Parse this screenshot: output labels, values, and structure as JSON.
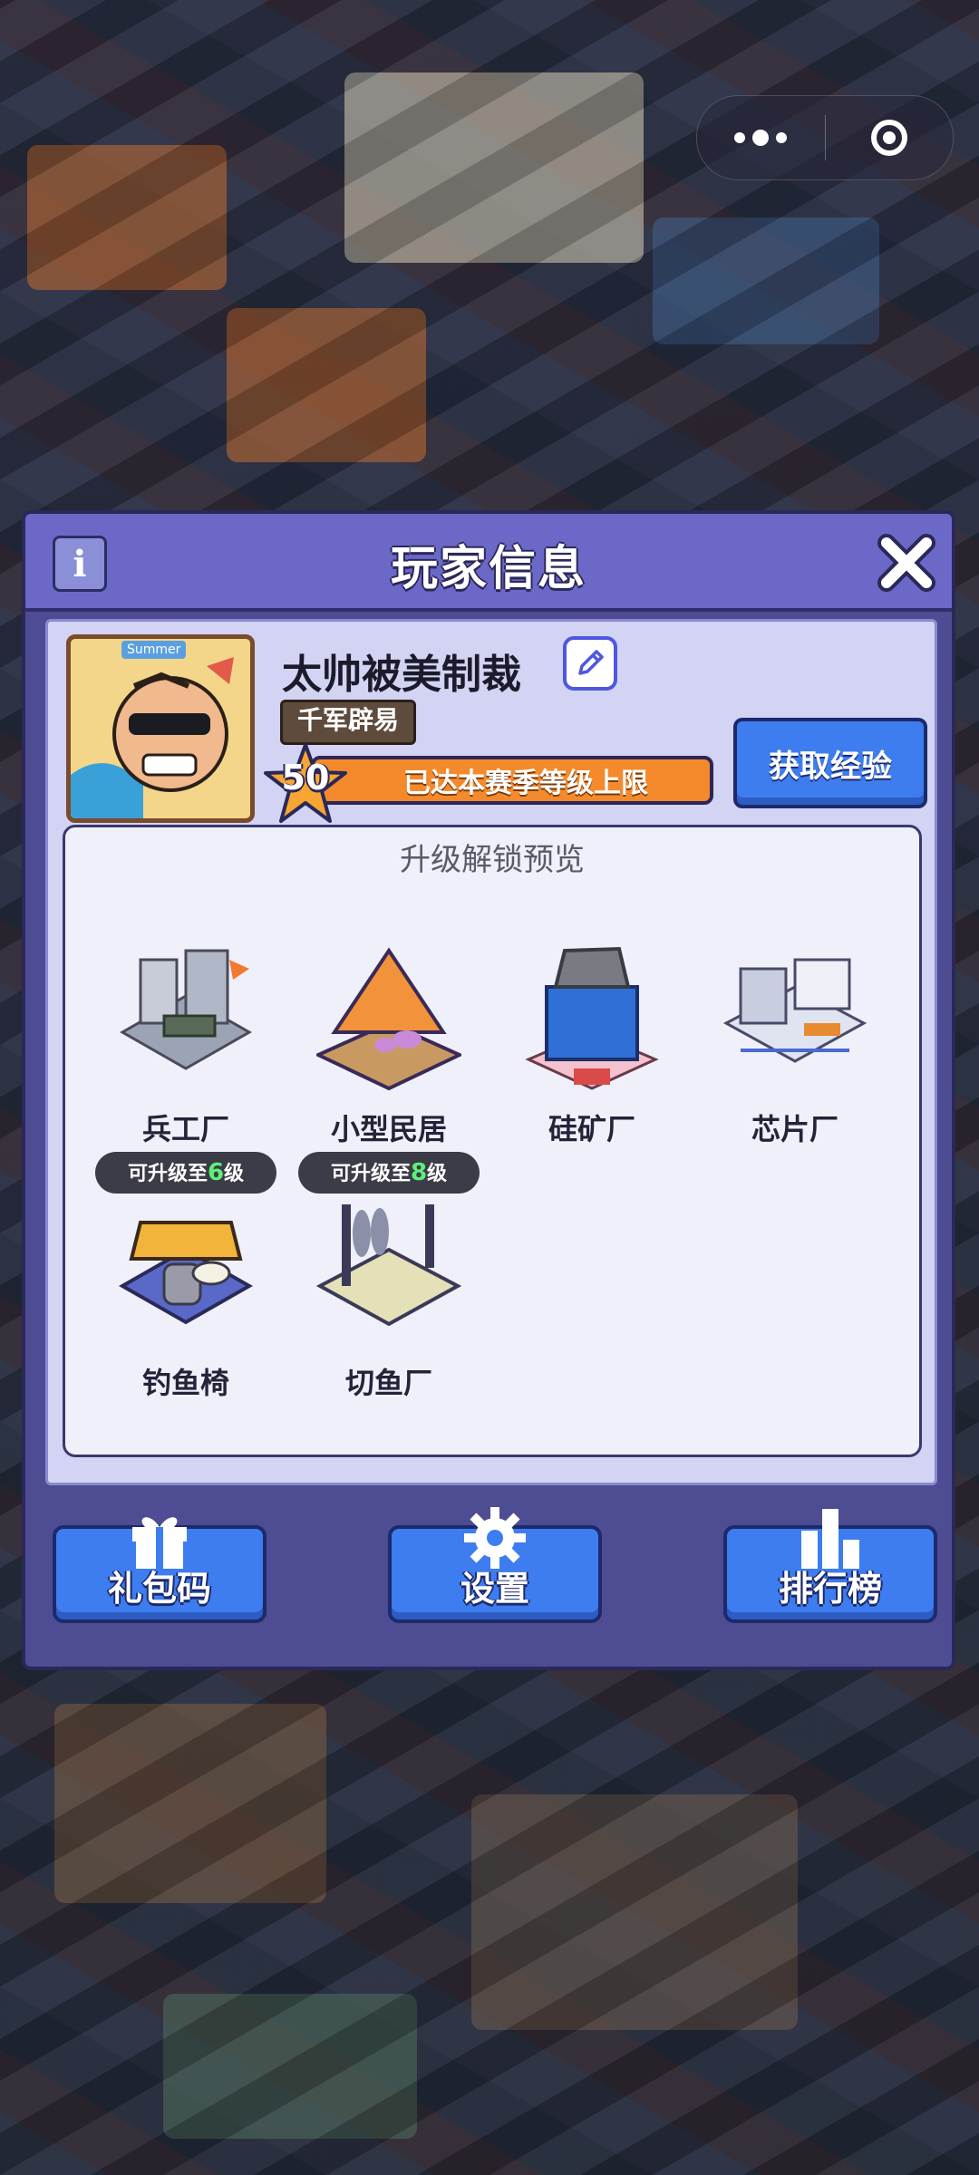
{
  "window": {
    "title": "玩家信息"
  },
  "capsule": {
    "menu_icon": "more-dots-icon",
    "close_icon": "target-circle-icon"
  },
  "player": {
    "name": "太帅被美制裁",
    "rank_title": "千军辟易",
    "level": "50",
    "level_status": "已达本赛季等级上限",
    "avatar_badge": "Summer",
    "get_exp_label": "获取经验"
  },
  "preview": {
    "title": "升级解锁预览",
    "buildings": [
      {
        "name": "兵工厂"
      },
      {
        "name": "小型民居"
      },
      {
        "name": "硅矿厂"
      },
      {
        "name": "芯片厂"
      },
      {
        "name": "钓鱼椅",
        "tag_prefix": "可升级至",
        "tag_level": "6",
        "tag_suffix": "级"
      },
      {
        "name": "切鱼厂",
        "tag_prefix": "可升级至",
        "tag_level": "8",
        "tag_suffix": "级"
      }
    ]
  },
  "footer": {
    "gift_code_label": "礼包码",
    "settings_label": "设置",
    "leaderboard_label": "排行榜"
  },
  "colors": {
    "modal_header": "#6b68c8",
    "modal_body": "#4e4c93",
    "panel": "#d3d3f3",
    "button_blue": "#3d7df0",
    "level_bar": "#f48a2c",
    "tag_level_green": "#5ff07a"
  }
}
